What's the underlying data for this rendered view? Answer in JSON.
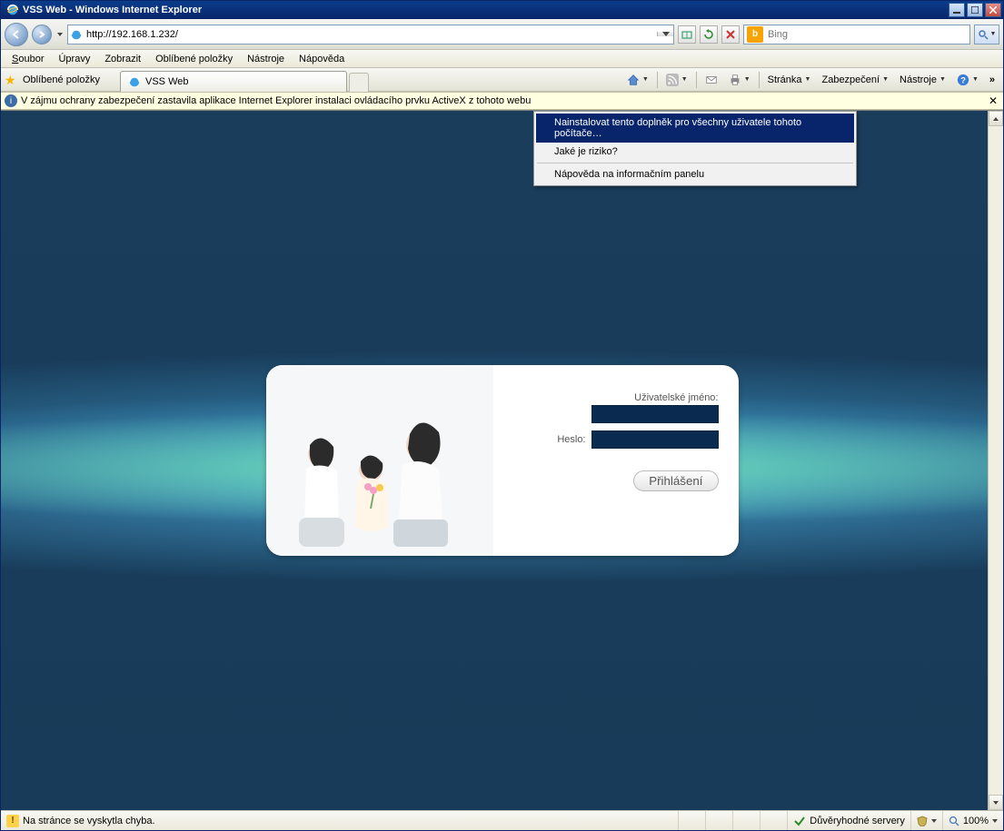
{
  "window": {
    "title": "VSS Web - Windows Internet Explorer"
  },
  "nav": {
    "url": "http://192.168.1.232/",
    "search_engine": "Bing",
    "search_placeholder": "Bing"
  },
  "menubar": {
    "file": "Soubor",
    "edit": "Úpravy",
    "view": "Zobrazit",
    "favorites": "Oblíbené položky",
    "tools": "Nástroje",
    "help": "Nápověda"
  },
  "favbar": {
    "favorites_label": "Oblíbené položky"
  },
  "tabs": [
    {
      "title": "VSS Web"
    }
  ],
  "cmdbar": {
    "page": "Stránka",
    "safety": "Zabezpečení",
    "tools": "Nástroje"
  },
  "infobar": {
    "message": "V zájmu ochrany zabezpečení zastavila aplikace Internet Explorer instalaci ovládacího prvku ActiveX z tohoto webu"
  },
  "context_menu": {
    "items": [
      "Nainstalovat tento doplněk pro všechny uživatele tohoto počítače…",
      "Jaké je riziko?",
      "Nápověda na informačním panelu"
    ]
  },
  "login": {
    "username_label": "Uživatelské jméno:",
    "password_label": "Heslo:",
    "submit": "Přihlášení",
    "username_value": "",
    "password_value": ""
  },
  "status": {
    "error_text": "Na stránce se vyskytla chyba.",
    "zone_text": "Důvěryhodné servery",
    "zoom": "100%"
  }
}
